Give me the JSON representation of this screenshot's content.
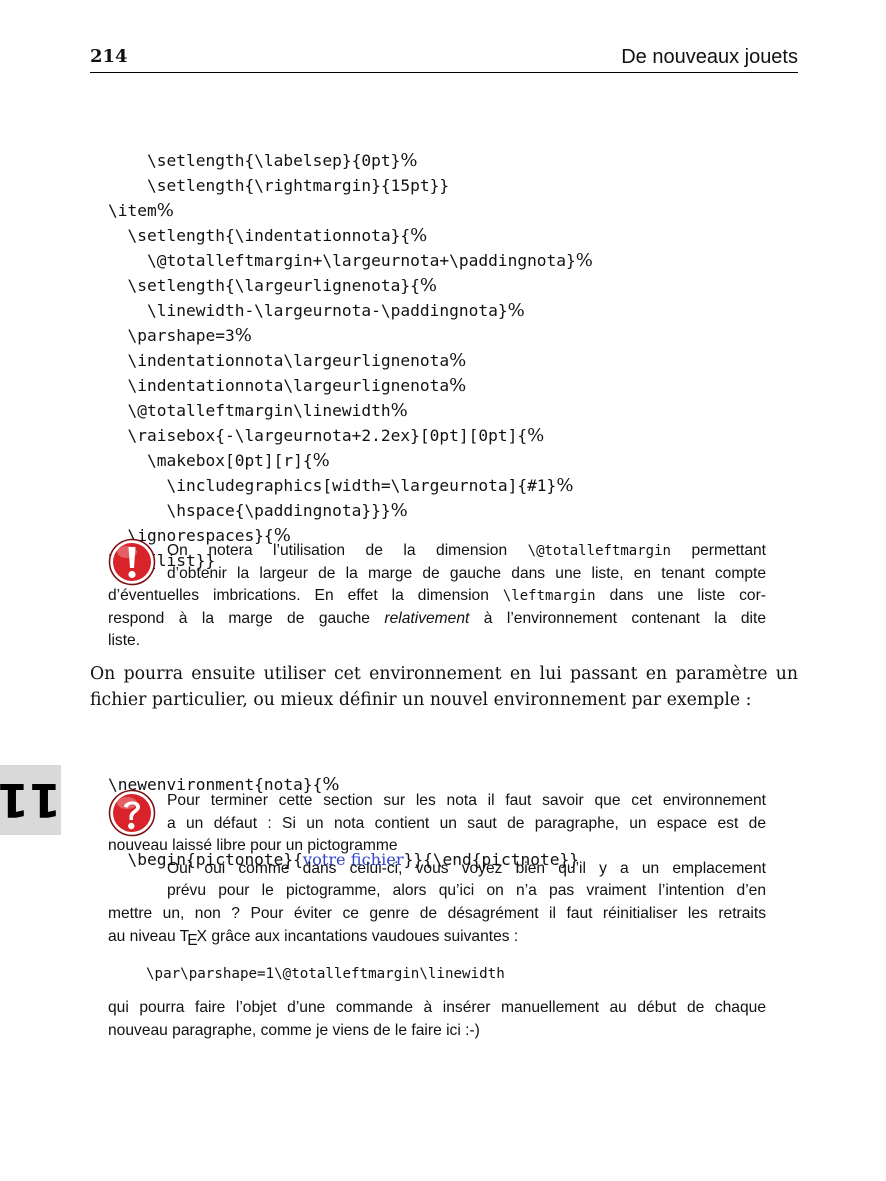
{
  "header": {
    "page_number": "214",
    "running_title": "De nouveaux jouets"
  },
  "code_block_1": [
    {
      "code": "    \\setlength{\\labelsep}{0pt}",
      "pct": "%"
    },
    {
      "code": "    \\setlength{\\rightmargin}{15pt}}",
      "pct": ""
    },
    {
      "code": "\\item",
      "pct": "%"
    },
    {
      "code": "  \\setlength{\\indentationnota}{",
      "pct": "%"
    },
    {
      "code": "    \\@totalleftmargin+\\largeurnota+\\paddingnota}",
      "pct": "%"
    },
    {
      "code": "  \\setlength{\\largeurlignenota}{",
      "pct": "%"
    },
    {
      "code": "    \\linewidth-\\largeurnota-\\paddingnota}",
      "pct": "%"
    },
    {
      "code": "  \\parshape=3",
      "pct": "%"
    },
    {
      "code": "  \\indentationnota\\largeurlignenota",
      "pct": "%"
    },
    {
      "code": "  \\indentationnota\\largeurlignenota",
      "pct": "%"
    },
    {
      "code": "  \\@totalleftmargin\\linewidth",
      "pct": "%"
    },
    {
      "code": "  \\raisebox{-\\largeurnota+2.2ex}[0pt][0pt]{",
      "pct": "%"
    },
    {
      "code": "    \\makebox[0pt][r]{",
      "pct": "%"
    },
    {
      "code": "      \\includegraphics[width=\\largeurnota]{#1}",
      "pct": "%"
    },
    {
      "code": "      \\hspace{\\paddingnota}}}",
      "pct": "%"
    },
    {
      "code": "  \\ignorespaces}{",
      "pct": "%"
    },
    {
      "code": "\\end{list}}",
      "pct": ""
    }
  ],
  "note_1": {
    "icon": "exclamation-icon",
    "line1_a": "On notera l’utilisation de la dimension ",
    "line1_tt": "\\@totalleftmargin",
    "line1_b": " permettant",
    "line2": "d’obtenir la largeur de la marge de gauche dans une liste, en tenant compte",
    "line3_a": "d’éventuelles imbrications. En effet la dimension ",
    "line3_tt": "\\leftmargin",
    "line3_b": " dans une liste cor-",
    "line4_a": "respond à la marge de gauche ",
    "line4_it": "relativement",
    "line4_b": " à l’environnement contenant la dite",
    "line5": "liste."
  },
  "body_paragraph": {
    "line1": "On pourra ensuite utiliser cet environnement en lui passant en paramètre un",
    "line2": "fichier particulier, ou mieux définir un nouvel environnement par exemple :"
  },
  "code_block_2": {
    "line1_code": "\\newenvironment{nota}{",
    "line1_pct": "%",
    "line2_a": "  \\begin{pictonote}{",
    "line2_link": "votre fichier",
    "line2_b": "}}{\\end{pictnote}}"
  },
  "chapter_tab": {
    "number": "11"
  },
  "note_2": {
    "icon": "question-icon",
    "line1": "Pour terminer cette section sur les nota il faut savoir que cet environnement",
    "line2": "a un défaut : Si un nota contient un saut de paragraphe, un espace est de",
    "line3": "nouveau laissé libre pour un pictogramme",
    "line4": "Oui oui comme dans celui-ci, vous voyez bien qu’il y a un emplacement",
    "line5": "prévu pour le pictogramme, alors qu’ici on n’a pas vraiment l’intention d’en",
    "line6": "mettre un, non ? Pour éviter ce genre de désagrément il faut réinitialiser les retraits",
    "line7_a": "au niveau T",
    "line7_e": "E",
    "line7_b": "X grâce aux incantations vaudoues suivantes :",
    "code": "\\par\\parshape=1\\@totalleftmargin\\linewidth",
    "line8": "qui pourra faire l’objet d’une commande à insérer manuellement au début de chaque",
    "line9": "nouveau paragraphe, comme je viens de le faire ici :-)"
  },
  "colors": {
    "icon_red": "#d8232a",
    "link_blue": "#3344cc",
    "tab_gray": "#d9d9d9"
  }
}
